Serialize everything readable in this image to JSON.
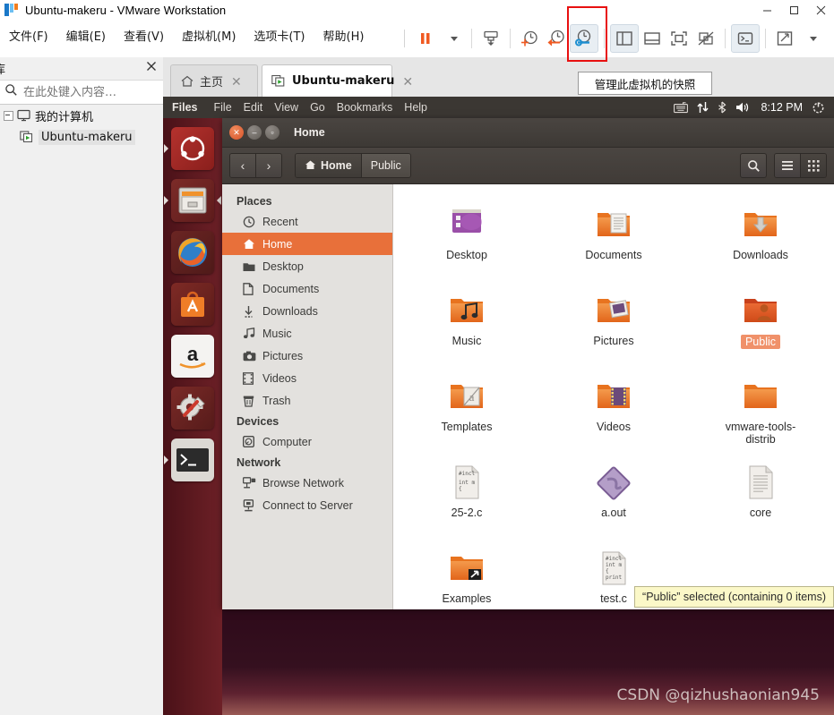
{
  "window": {
    "title": "Ubuntu-makeru - VMware Workstation",
    "app_icon": "vmware-logo-icon",
    "controls": [
      {
        "name": "minimize-button",
        "glyph": "minimize-icon"
      },
      {
        "name": "maximize-button",
        "glyph": "maximize-icon"
      },
      {
        "name": "close-button",
        "glyph": "close-icon"
      }
    ]
  },
  "menubar": {
    "items": [
      {
        "label": "文件(F)",
        "name": "menu-file"
      },
      {
        "label": "编辑(E)",
        "name": "menu-edit"
      },
      {
        "label": "查看(V)",
        "name": "menu-view"
      },
      {
        "label": "虚拟机(M)",
        "name": "menu-vm"
      },
      {
        "label": "选项卡(T)",
        "name": "menu-tabs"
      },
      {
        "label": "帮助(H)",
        "name": "menu-help"
      }
    ]
  },
  "toolbar": {
    "buttons": [
      {
        "name": "suspend-button",
        "icon": "pause-icon"
      },
      {
        "name": "power-dropdown",
        "icon": "chevron-down-icon"
      },
      {
        "name": "send-ctrl-alt-del-button",
        "icon": "send-key-icon"
      },
      {
        "name": "take-snapshot-button",
        "icon": "snapshot-add-icon"
      },
      {
        "name": "revert-snapshot-button",
        "icon": "snapshot-revert-icon"
      },
      {
        "name": "manage-snapshots-button",
        "icon": "snapshot-manage-icon"
      },
      {
        "name": "show-library-button",
        "icon": "panel-left-icon"
      },
      {
        "name": "show-thumbnail-bar-button",
        "icon": "panel-bottom-icon"
      },
      {
        "name": "show-full-screen-button",
        "icon": "fullscreen-frame-icon"
      },
      {
        "name": "unity-mode-button",
        "icon": "unity-off-icon"
      },
      {
        "name": "console-button",
        "icon": "terminal-icon"
      },
      {
        "name": "stretch-button",
        "icon": "stretch-arrows-icon"
      },
      {
        "name": "stretch-dropdown",
        "icon": "chevron-down-icon"
      }
    ],
    "tooltip": "管理此虚拟机的快照",
    "highlight_color": "#e81010"
  },
  "library": {
    "title": "库",
    "close_label": "✕",
    "search": {
      "value": "",
      "placeholder": "在此处键入内容…"
    },
    "tree": [
      {
        "label": "我的计算机",
        "name": "tree-item-my-computer",
        "icon": "computer-icon",
        "level": 0,
        "selected": false
      },
      {
        "label": "Ubuntu-makeru",
        "name": "tree-item-ubuntu-makeru",
        "icon": "vm-running-icon",
        "level": 1,
        "selected": true
      }
    ]
  },
  "tabs": [
    {
      "label": "主页",
      "name": "tab-home",
      "icon": "home-icon",
      "active": false,
      "close": "✕"
    },
    {
      "label": "Ubuntu-makeru",
      "name": "tab-ubuntu-makeru",
      "icon": "vm-running-icon",
      "active": true,
      "close": "✕"
    }
  ],
  "guest": {
    "panel": {
      "app_name": "Files",
      "menus": [
        "File",
        "Edit",
        "View",
        "Go",
        "Bookmarks",
        "Help"
      ],
      "indicators": [
        "keyboard-icon",
        "network-icon",
        "bluetooth-icon",
        "volume-icon"
      ],
      "clock": "8:12 PM",
      "session_icon": "power-gear-icon"
    },
    "launcher": [
      {
        "name": "launcher-item-dash",
        "icon": "ubuntu-dash-icon"
      },
      {
        "name": "launcher-item-files",
        "icon": "file-manager-icon"
      },
      {
        "name": "launcher-item-firefox",
        "icon": "firefox-icon"
      },
      {
        "name": "launcher-item-software-center",
        "icon": "software-center-icon"
      },
      {
        "name": "launcher-item-amazon",
        "icon": "amazon-icon"
      },
      {
        "name": "launcher-item-system-settings",
        "icon": "system-settings-icon"
      },
      {
        "name": "launcher-item-terminal",
        "icon": "terminal-icon"
      }
    ],
    "nautilus": {
      "window_title": "Home",
      "window_buttons": [
        "close-icon",
        "minimize-icon",
        "maximize-icon"
      ],
      "nav": {
        "back": "‹",
        "forward": "›"
      },
      "breadcrumbs": [
        {
          "label": "Home",
          "icon": "home-icon",
          "current": false
        },
        {
          "label": "Public",
          "icon": "",
          "current": true
        }
      ],
      "toolbar_right": [
        "search-icon",
        "hamburger-menu-icon",
        "view-grid-icon"
      ],
      "sidebar": [
        {
          "type": "header",
          "label": "Places"
        },
        {
          "type": "item",
          "label": "Recent",
          "icon": "clock-icon",
          "selected": false
        },
        {
          "type": "item",
          "label": "Home",
          "icon": "home-icon",
          "selected": true
        },
        {
          "type": "item",
          "label": "Desktop",
          "icon": "folder-icon",
          "selected": false
        },
        {
          "type": "item",
          "label": "Documents",
          "icon": "document-icon",
          "selected": false
        },
        {
          "type": "item",
          "label": "Downloads",
          "icon": "download-icon",
          "selected": false
        },
        {
          "type": "item",
          "label": "Music",
          "icon": "music-note-icon",
          "selected": false
        },
        {
          "type": "item",
          "label": "Pictures",
          "icon": "camera-icon",
          "selected": false
        },
        {
          "type": "item",
          "label": "Videos",
          "icon": "film-icon",
          "selected": false
        },
        {
          "type": "item",
          "label": "Trash",
          "icon": "trash-icon",
          "selected": false
        },
        {
          "type": "header",
          "label": "Devices"
        },
        {
          "type": "item",
          "label": "Computer",
          "icon": "disk-icon",
          "selected": false
        },
        {
          "type": "header",
          "label": "Network"
        },
        {
          "type": "item",
          "label": "Browse Network",
          "icon": "network-browse-icon",
          "selected": false
        },
        {
          "type": "item",
          "label": "Connect to Server",
          "icon": "server-connect-icon",
          "selected": false
        }
      ],
      "files": [
        {
          "label": "Desktop",
          "icon": "desktop-folder-icon",
          "selected": false
        },
        {
          "label": "Documents",
          "icon": "documents-folder-icon",
          "selected": false
        },
        {
          "label": "Downloads",
          "icon": "downloads-folder-icon",
          "selected": false
        },
        {
          "label": "Music",
          "icon": "music-folder-icon",
          "selected": false
        },
        {
          "label": "Pictures",
          "icon": "pictures-folder-icon",
          "selected": false
        },
        {
          "label": "Public",
          "icon": "public-folder-icon",
          "selected": true
        },
        {
          "label": "Templates",
          "icon": "templates-folder-icon",
          "selected": false
        },
        {
          "label": "Videos",
          "icon": "videos-folder-icon",
          "selected": false
        },
        {
          "label": "vmware-tools-distrib",
          "icon": "folder-icon",
          "selected": false
        },
        {
          "label": "25-2.c",
          "icon": "c-source-file-icon",
          "selected": false
        },
        {
          "label": "a.out",
          "icon": "executable-binary-icon",
          "selected": false
        },
        {
          "label": "core",
          "icon": "text-file-icon",
          "selected": false
        },
        {
          "label": "Examples",
          "icon": "folder-link-icon",
          "selected": false
        },
        {
          "label": "test.c",
          "icon": "c-source-file-icon",
          "selected": false
        }
      ],
      "status": "“Public” selected  (containing 0 items)"
    },
    "watermark": "CSDN @qizhushaonian945"
  },
  "colors": {
    "ubuntu_orange": "#e8703a",
    "vmware_blue": "#1a78c8",
    "highlight_red": "#e81010",
    "status_yellow": "#fbf8c8"
  }
}
